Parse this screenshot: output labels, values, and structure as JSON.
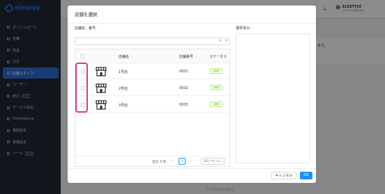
{
  "app": {
    "logo_text": "elepay",
    "sidebar": {
      "items": [
        {
          "label": "ダッシュボード",
          "active": false,
          "chevron": false,
          "tag": ""
        },
        {
          "label": "店舗",
          "active": false,
          "chevron": false,
          "tag": ""
        },
        {
          "label": "商品",
          "active": false,
          "chevron": true,
          "tag": ""
        },
        {
          "label": "注文",
          "active": false,
          "chevron": false,
          "tag": ""
        },
        {
          "label": "店舗スタッフ",
          "active": true,
          "chevron": false,
          "tag": ""
        },
        {
          "label": "ユーザー",
          "active": false,
          "chevron": false,
          "tag": ""
        },
        {
          "label": "統計",
          "active": false,
          "chevron": false,
          "tag": "Beta"
        },
        {
          "label": "サービス設定",
          "active": false,
          "chevron": true,
          "tag": ""
        },
        {
          "label": "Marketplace",
          "active": false,
          "chevron": false,
          "tag": ""
        },
        {
          "label": "機能設定",
          "active": false,
          "chevron": true,
          "tag": ""
        },
        {
          "label": "業務設定",
          "active": false,
          "chevron": false,
          "tag": ""
        },
        {
          "label": "ツール",
          "active": false,
          "chevron": false,
          "tag": "Beta"
        }
      ]
    },
    "header": {
      "user_name": "ELESTYLE",
      "user_sub": "ELESTYLE株式会社"
    },
    "background_text": "ます。",
    "footer_text": "データがありません"
  },
  "modal": {
    "title": "店舗を選択",
    "search_label": "店舗名、番号:",
    "search_value": "",
    "search_placeholder": "",
    "selected_label": "選択済み：",
    "columns": {
      "name": "店舗名",
      "number": "店舗番号",
      "status": "ステータス"
    },
    "rows": [
      {
        "name": "1号店",
        "number": "0001",
        "status": "公開中"
      },
      {
        "name": "2号店",
        "number": "0002",
        "status": "公開中"
      },
      {
        "name": "3号店",
        "number": "0003",
        "status": "公開中"
      }
    ],
    "pagination": {
      "total": "合計 3 件",
      "prev": "<",
      "current": "1",
      "next": ">",
      "page_size": "10 / ページ"
    },
    "buttons": {
      "cancel": "キャンセル",
      "ok": "OK"
    },
    "colors": {
      "primary": "#1890ff",
      "highlight": "#e0338c",
      "status_green": "#52c41a"
    }
  }
}
